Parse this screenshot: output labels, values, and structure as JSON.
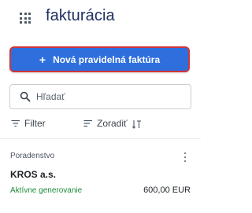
{
  "header": {
    "title": "fakturácia",
    "apps_icon": "grid-apps-icon"
  },
  "actions": {
    "new_recurring_invoice_label": "Nová pravidelná faktúra",
    "plus_glyph": "+"
  },
  "search": {
    "placeholder": "Hľadať",
    "value": "",
    "icon": "search-icon"
  },
  "toolbar": {
    "filter_label": "Filter",
    "sort_label": "Zoradiť",
    "filter_icon": "filter-lines-icon",
    "sort_icon": "sort-lines-icon",
    "sort_direction_icon": "sort-direction-icon"
  },
  "invoices": [
    {
      "category": "Poradenstvo",
      "company": "KROS a.s.",
      "status": "Aktívne generovanie",
      "amount": "600,00 EUR"
    }
  ],
  "colors": {
    "primary": "#2f6fdd",
    "title": "#1e2f62",
    "status_active": "#1e8a3a",
    "focus_outline": "#d0343a"
  }
}
